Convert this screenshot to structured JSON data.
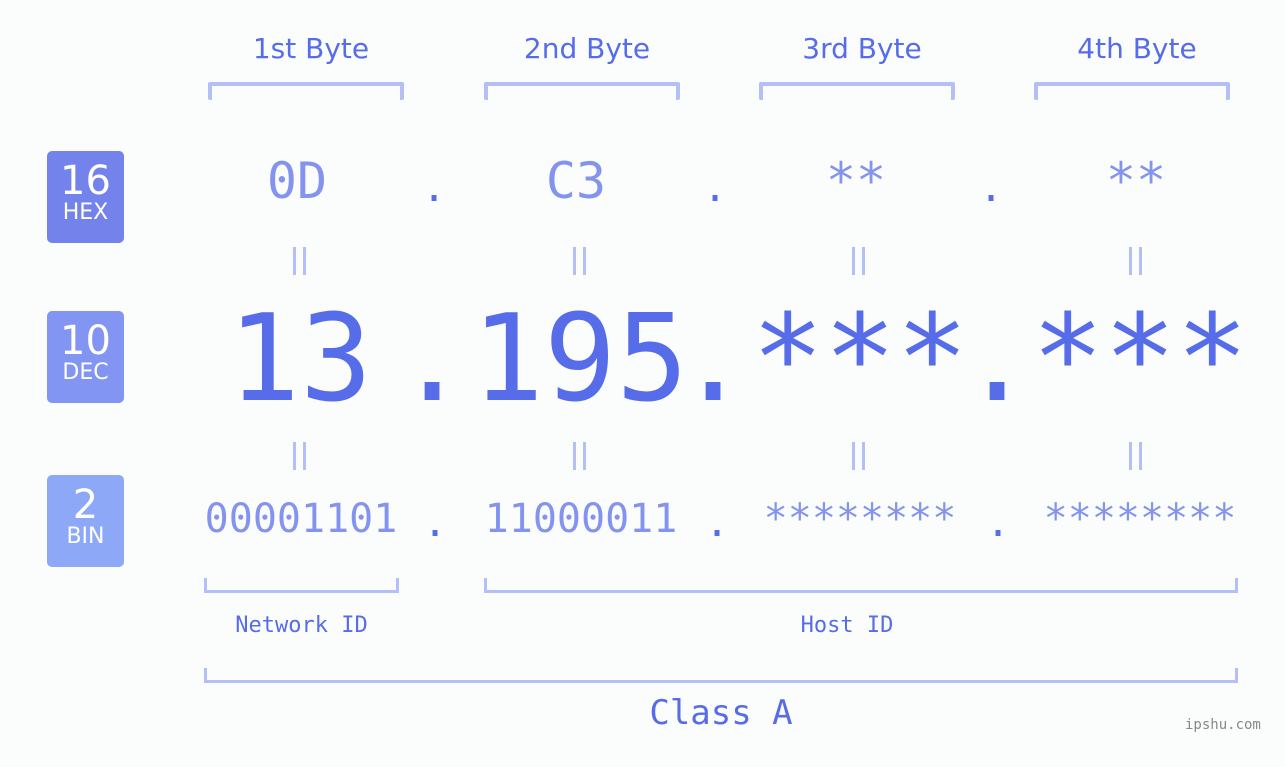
{
  "bases": [
    {
      "number": "16",
      "label": "HEX"
    },
    {
      "number": "10",
      "label": "DEC"
    },
    {
      "number": "2",
      "label": "BIN"
    }
  ],
  "bytes": [
    {
      "label": "1st Byte",
      "hex": "0D",
      "dec": "13",
      "bin": "00001101"
    },
    {
      "label": "2nd Byte",
      "hex": "C3",
      "dec": "195",
      "bin": "11000011"
    },
    {
      "label": "3rd Byte",
      "hex": "**",
      "dec": "***",
      "bin": "********"
    },
    {
      "label": "4th Byte",
      "hex": "**",
      "dec": "***",
      "bin": "********"
    }
  ],
  "separator": ".",
  "network_label": "Network ID",
  "host_label": "Host ID",
  "class_label": "Class A",
  "watermark": "ipshu.com",
  "colors": {
    "primary": "#566ce8",
    "light": "#8494ee",
    "bracket": "#b3bff6"
  }
}
